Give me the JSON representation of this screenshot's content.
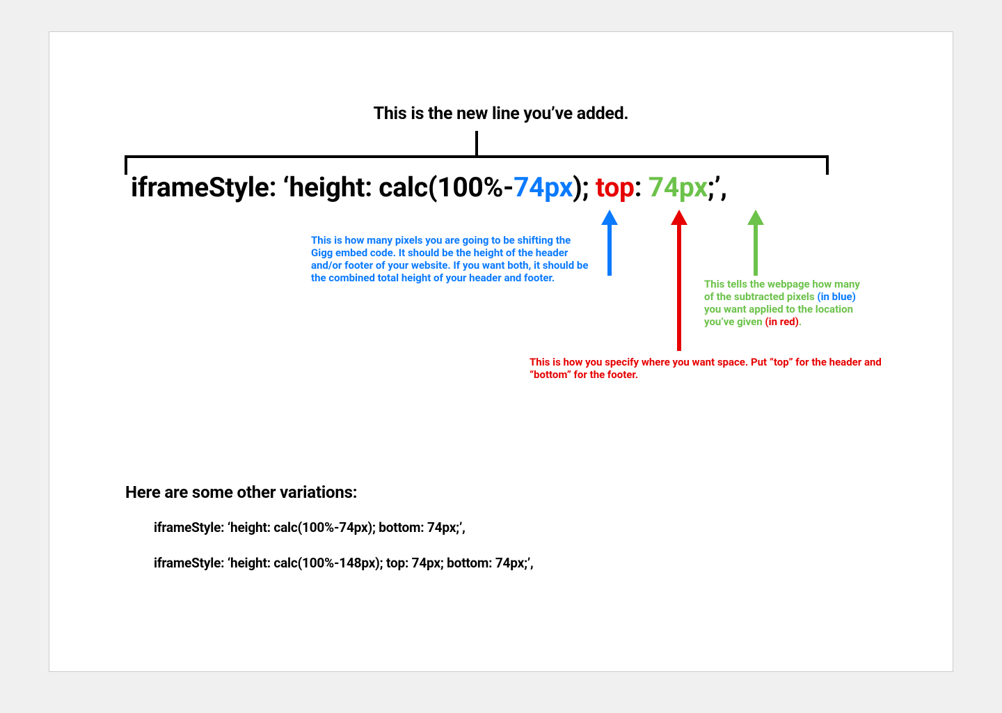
{
  "title": "This is the new line you’ve added.",
  "code": {
    "seg1": "iframeStyle: ‘height: calc(100%-",
    "blue": "74px",
    "seg2": "); ",
    "red": "top",
    "seg3": ": ",
    "green": "74px",
    "seg4": ";’,"
  },
  "notes": {
    "blue": "This is how many pixels you are going to be shifting the Gigg embed code. It should be the height of the header and/or footer of your website. If you want both, it should be the combined total height of your header and footer.",
    "red": "This is how you specify where you want space. Put “top” for the header and “bottom” for the footer.",
    "green_part1": "This tells the webpage how many of the subtracted pixels ",
    "green_inblue": "(in blue)",
    "green_part2": " you want applied to the location you’ve given ",
    "green_inred": "(in red)",
    "green_part3": "."
  },
  "variations": {
    "heading": "Here are some other variations:",
    "v1": "iframeStyle: ‘height: calc(100%-74px); bottom: 74px;’,",
    "v2": "iframeStyle: ‘height: calc(100%-148px); top: 74px; bottom: 74px;’,"
  }
}
